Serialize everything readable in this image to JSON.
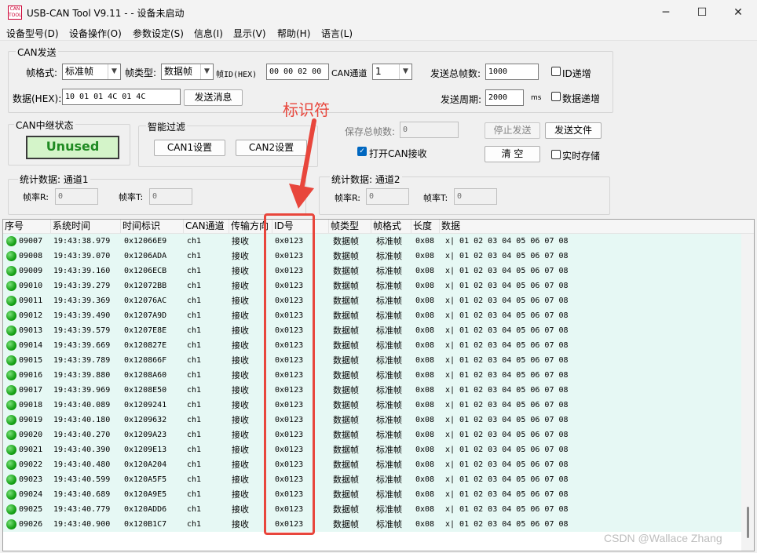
{
  "window": {
    "title": "USB-CAN Tool V9.11 - - 设备未启动",
    "app_icon_text": "CAN TOOL",
    "controls": [
      "─",
      "☐",
      "✕"
    ]
  },
  "menu": [
    "设备型号(D)",
    "设备操作(O)",
    "参数设定(S)",
    "信息(I)",
    "显示(V)",
    "帮助(H)",
    "语言(L)"
  ],
  "can_send": {
    "group_title": "CAN发送",
    "frame_format_label": "帧格式:",
    "frame_format_value": "标准帧",
    "frame_type_label": "帧类型:",
    "frame_type_value": "数据帧",
    "frame_id_label": "帧ID(HEX)",
    "frame_id_value": "00 00 02 00",
    "channel_label": "CAN通道",
    "channel_value": "1",
    "total_send_label": "发送总帧数:",
    "total_send_value": "1000",
    "id_inc_label": "ID递增",
    "data_label": "数据(HEX):",
    "data_value": "10 01 01 4C 01 4C",
    "send_button": "发送消息",
    "period_label": "发送周期:",
    "period_value": "2000",
    "period_unit": "ms",
    "data_inc_label": "数据递增"
  },
  "relay": {
    "group_title": "CAN中继状态",
    "status": "Unused"
  },
  "filter": {
    "group_title": "智能过滤",
    "can1_button": "CAN1设置",
    "can2_button": "CAN2设置"
  },
  "save": {
    "total_label": "保存总帧数:",
    "total_value": "0",
    "open_can_label": "打开CAN接收",
    "open_can_checked": true,
    "stop_button": "停止发送",
    "send_file_button": "发送文件",
    "clear_button": "清 空",
    "realtime_label": "实时存储"
  },
  "stats1": {
    "title": "统计数据: 通道1",
    "rate_r_label": "帧率R:",
    "rate_r": "0",
    "rate_t_label": "帧率T:",
    "rate_t": "0"
  },
  "stats2": {
    "title": "统计数据: 通道2",
    "rate_r_label": "帧率R:",
    "rate_r": "0",
    "rate_t_label": "帧率T:",
    "rate_t": "0"
  },
  "table": {
    "columns": [
      "序号",
      "系统时间",
      "时间标识",
      "CAN通道",
      "传输方向",
      "ID号",
      "帧类型",
      "帧格式",
      "长度",
      "数据"
    ],
    "rows": [
      [
        "09007",
        "19:43:38.979",
        "0x12066E9",
        "ch1",
        "接收",
        "0x0123",
        "数据帧",
        "标准帧",
        "0x08",
        "x| 01 02 03 04 05 06 07 08"
      ],
      [
        "09008",
        "19:43:39.070",
        "0x1206ADA",
        "ch1",
        "接收",
        "0x0123",
        "数据帧",
        "标准帧",
        "0x08",
        "x| 01 02 03 04 05 06 07 08"
      ],
      [
        "09009",
        "19:43:39.160",
        "0x1206ECB",
        "ch1",
        "接收",
        "0x0123",
        "数据帧",
        "标准帧",
        "0x08",
        "x| 01 02 03 04 05 06 07 08"
      ],
      [
        "09010",
        "19:43:39.279",
        "0x12072BB",
        "ch1",
        "接收",
        "0x0123",
        "数据帧",
        "标准帧",
        "0x08",
        "x| 01 02 03 04 05 06 07 08"
      ],
      [
        "09011",
        "19:43:39.369",
        "0x12076AC",
        "ch1",
        "接收",
        "0x0123",
        "数据帧",
        "标准帧",
        "0x08",
        "x| 01 02 03 04 05 06 07 08"
      ],
      [
        "09012",
        "19:43:39.490",
        "0x1207A9D",
        "ch1",
        "接收",
        "0x0123",
        "数据帧",
        "标准帧",
        "0x08",
        "x| 01 02 03 04 05 06 07 08"
      ],
      [
        "09013",
        "19:43:39.579",
        "0x1207E8E",
        "ch1",
        "接收",
        "0x0123",
        "数据帧",
        "标准帧",
        "0x08",
        "x| 01 02 03 04 05 06 07 08"
      ],
      [
        "09014",
        "19:43:39.669",
        "0x120827E",
        "ch1",
        "接收",
        "0x0123",
        "数据帧",
        "标准帧",
        "0x08",
        "x| 01 02 03 04 05 06 07 08"
      ],
      [
        "09015",
        "19:43:39.789",
        "0x120866F",
        "ch1",
        "接收",
        "0x0123",
        "数据帧",
        "标准帧",
        "0x08",
        "x| 01 02 03 04 05 06 07 08"
      ],
      [
        "09016",
        "19:43:39.880",
        "0x1208A60",
        "ch1",
        "接收",
        "0x0123",
        "数据帧",
        "标准帧",
        "0x08",
        "x| 01 02 03 04 05 06 07 08"
      ],
      [
        "09017",
        "19:43:39.969",
        "0x1208E50",
        "ch1",
        "接收",
        "0x0123",
        "数据帧",
        "标准帧",
        "0x08",
        "x| 01 02 03 04 05 06 07 08"
      ],
      [
        "09018",
        "19:43:40.089",
        "0x1209241",
        "ch1",
        "接收",
        "0x0123",
        "数据帧",
        "标准帧",
        "0x08",
        "x| 01 02 03 04 05 06 07 08"
      ],
      [
        "09019",
        "19:43:40.180",
        "0x1209632",
        "ch1",
        "接收",
        "0x0123",
        "数据帧",
        "标准帧",
        "0x08",
        "x| 01 02 03 04 05 06 07 08"
      ],
      [
        "09020",
        "19:43:40.270",
        "0x1209A23",
        "ch1",
        "接收",
        "0x0123",
        "数据帧",
        "标准帧",
        "0x08",
        "x| 01 02 03 04 05 06 07 08"
      ],
      [
        "09021",
        "19:43:40.390",
        "0x1209E13",
        "ch1",
        "接收",
        "0x0123",
        "数据帧",
        "标准帧",
        "0x08",
        "x| 01 02 03 04 05 06 07 08"
      ],
      [
        "09022",
        "19:43:40.480",
        "0x120A204",
        "ch1",
        "接收",
        "0x0123",
        "数据帧",
        "标准帧",
        "0x08",
        "x| 01 02 03 04 05 06 07 08"
      ],
      [
        "09023",
        "19:43:40.599",
        "0x120A5F5",
        "ch1",
        "接收",
        "0x0123",
        "数据帧",
        "标准帧",
        "0x08",
        "x| 01 02 03 04 05 06 07 08"
      ],
      [
        "09024",
        "19:43:40.689",
        "0x120A9E5",
        "ch1",
        "接收",
        "0x0123",
        "数据帧",
        "标准帧",
        "0x08",
        "x| 01 02 03 04 05 06 07 08"
      ],
      [
        "09025",
        "19:43:40.779",
        "0x120ADD6",
        "ch1",
        "接收",
        "0x0123",
        "数据帧",
        "标准帧",
        "0x08",
        "x| 01 02 03 04 05 06 07 08"
      ],
      [
        "09026",
        "19:43:40.900",
        "0x120B1C7",
        "ch1",
        "接收",
        "0x0123",
        "数据帧",
        "标准帧",
        "0x08",
        "x| 01 02 03 04 05 06 07 08"
      ]
    ]
  },
  "annotation": {
    "label": "标识符",
    "color": "#e8463c"
  },
  "watermark": "CSDN @Wallace Zhang"
}
